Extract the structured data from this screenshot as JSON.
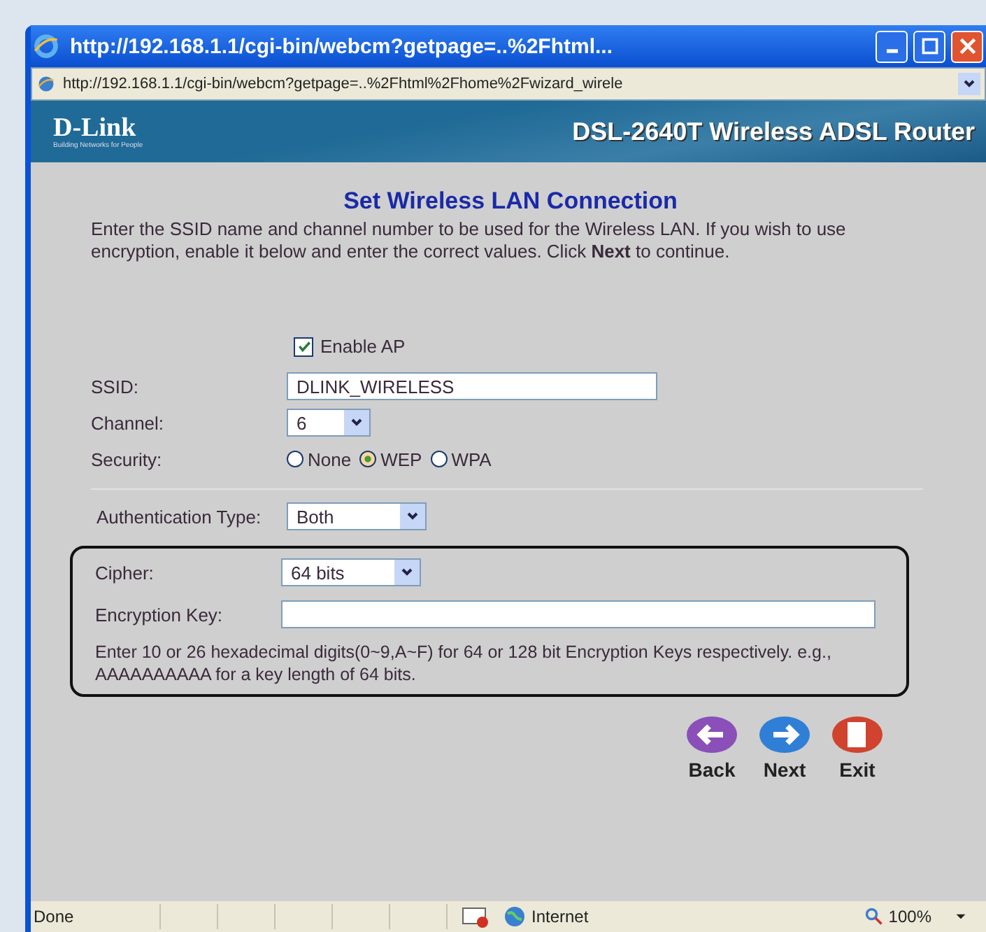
{
  "window": {
    "title": "http://192.168.1.1/cgi-bin/webcm?getpage=..%2Fhtml..."
  },
  "address_bar": {
    "url": "http://192.168.1.1/cgi-bin/webcm?getpage=..%2Fhtml%2Fhome%2Fwizard_wirele"
  },
  "banner": {
    "logo": "D-Link",
    "tagline": "Building Networks for People",
    "product": "DSL-2640T Wireless ADSL Router"
  },
  "form": {
    "heading": "Set Wireless LAN Connection",
    "intro": "Enter the SSID name and channel number to be used for the Wireless LAN. If you wish to use encryption, enable it below and enter the correct values. Click **Next** to continue.",
    "enable_ap": {
      "label": "Enable AP",
      "checked": true
    },
    "rows": [
      {
        "kind": "text",
        "label": "SSID:",
        "value": "DLINK_WIRELESS"
      },
      {
        "kind": "select",
        "label": "Channel:",
        "value": "6"
      },
      {
        "kind": "radio",
        "label": "Security:",
        "options": [
          {
            "label": "None",
            "selected": false
          },
          {
            "label": "WEP",
            "selected": true
          },
          {
            "label": "WPA",
            "selected": false
          }
        ]
      }
    ],
    "auth_rows": [
      {
        "kind": "select",
        "label": "Authentication Type:",
        "value": "Both"
      }
    ],
    "highlighted_rows": [
      {
        "kind": "select",
        "label": "Cipher:",
        "value": "64 bits"
      },
      {
        "kind": "text",
        "label": "Encryption Key:"
      }
    ],
    "note": "Enter 10 or 26 hexadecimal digits(0~9,A~F) for 64 or 128 bit Encryption Keys respectively. e.g., AAAAAAAAAA for a key length of 64 bits."
  },
  "actions": [
    {
      "kind": "back",
      "label": "Back"
    },
    {
      "kind": "next",
      "label": "Next"
    },
    {
      "kind": "exit",
      "label": "Exit"
    }
  ],
  "status_bar": {
    "status": "Done",
    "zone": "Internet",
    "zoom": "100%"
  }
}
